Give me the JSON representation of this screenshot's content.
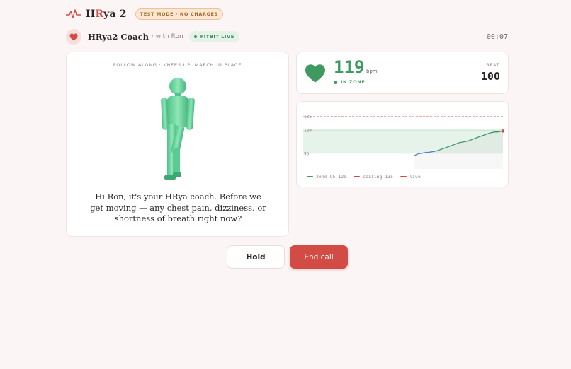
{
  "app": {
    "name_prefix": "H",
    "name_highlight": "R",
    "name_suffix": "ya 2",
    "mode_badge": "TEST MODE · NO CHARGES"
  },
  "coach": {
    "name": "HRya2 Coach",
    "with": "· with Ron",
    "source_badge": "FITBIT LIVE",
    "timer": "00:07"
  },
  "stage": {
    "caption": "FOLLOW ALONG · KNEES UP, MARCH IN PLACE",
    "message": "Hi Ron, it's your HRya coach. Before we get moving — any chest pain, dizziness, or shortness of breath right now?"
  },
  "heart_rate": {
    "value": "119",
    "unit": "bpm",
    "status": "IN ZONE",
    "beat_label": "BEAT",
    "beat_value": "100"
  },
  "colors": {
    "accent": "#d24b44",
    "zone": "#3e9a61",
    "live_early": "#5b7ec4"
  },
  "chart_data": {
    "type": "line",
    "ylim": [
      78,
      143
    ],
    "ytick_labels": [
      "135",
      "120",
      "95"
    ],
    "yticks": [
      135,
      120,
      95
    ],
    "zone": [
      95,
      120
    ],
    "ceiling": 135,
    "series": [
      {
        "name": "live",
        "x": [
          0,
          1,
          2,
          3,
          4,
          5,
          6,
          7,
          8,
          9,
          10,
          11,
          12,
          13,
          14,
          15,
          16,
          17,
          18,
          19,
          20,
          21,
          22,
          23,
          24,
          25,
          26,
          27,
          28,
          29,
          30,
          31,
          32,
          33,
          34,
          35
        ],
        "values": [
          92,
          93.5,
          94.5,
          95,
          95.5,
          96,
          96,
          96.5,
          97,
          97.5,
          98.5,
          99.5,
          100.5,
          101.5,
          102.5,
          103.5,
          104.5,
          105.5,
          106.5,
          107,
          107.5,
          108,
          109,
          110,
          111,
          112,
          113,
          114,
          115,
          116,
          117,
          117.5,
          118,
          118,
          118.5,
          119
        ]
      }
    ],
    "legend": [
      "zone 95–120",
      "ceiling 135",
      "live"
    ]
  },
  "actions": {
    "hold": "Hold",
    "end_call": "End call"
  }
}
